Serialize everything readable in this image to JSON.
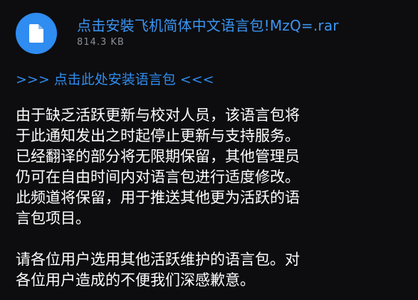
{
  "message": {
    "file": {
      "name": "点击安裝飞机简体中文语言包!MzQ=.rar",
      "size": "814.3 KB",
      "icon": "file-icon",
      "icon_color": "#2f8cf0"
    },
    "install_link": ">>> 点击此处安装语言包 <<<",
    "paragraph1": [
      "由于缺乏活跃更新与校对人员，该语言包将",
      "于此通知发出之时起停止更新与支持服务。",
      "已经翻译的部分将无限期保留，其他管理员",
      "仍可在自由时间内对语言包进行适度修改。",
      "此频道将保留，用于推送其他更为活跃的语",
      "言包项目。"
    ],
    "paragraph2": [
      "请各位用户选用其他活跃维护的语言包。对",
      "各位用户造成的不便我们深感歉意。"
    ]
  }
}
